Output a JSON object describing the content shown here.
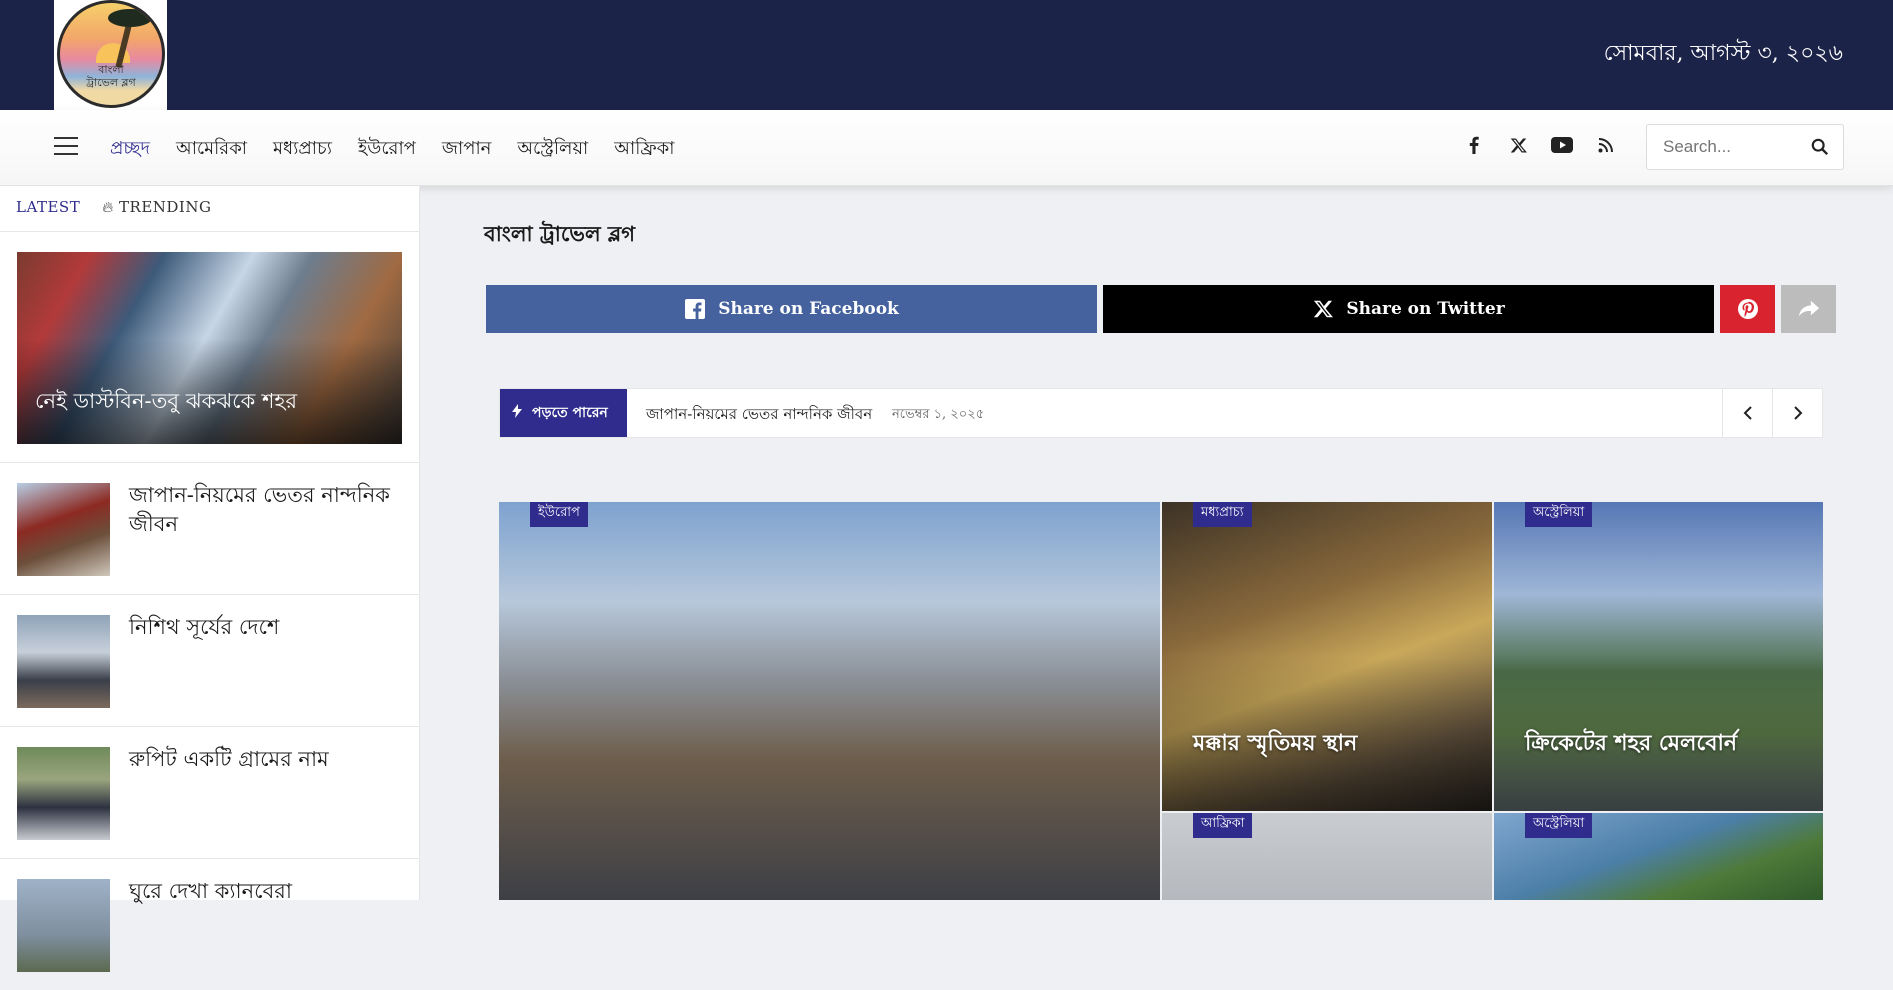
{
  "header": {
    "logo_text_line1": "বাংলা",
    "logo_text_line2": "ট্রাভেল ব্লগ",
    "date": "সোমবার, আগস্ট ৩, ২০২৬"
  },
  "nav": {
    "menu_icon": "hamburger-icon",
    "items": [
      {
        "label": "প্রচ্ছদ",
        "active": true
      },
      {
        "label": "আমেরিকা"
      },
      {
        "label": "মধ্যপ্রাচ্য"
      },
      {
        "label": "ইউরোপ"
      },
      {
        "label": "জাপান"
      },
      {
        "label": "অস্ট্রেলিয়া"
      },
      {
        "label": "আফ্রিকা"
      }
    ],
    "social": [
      "facebook-icon",
      "x-icon",
      "youtube-icon",
      "rss-icon"
    ],
    "search_placeholder": "Search..."
  },
  "sidebar": {
    "tabs": [
      {
        "label": "LATEST",
        "active": true
      },
      {
        "label": "TRENDING",
        "icon": "flame-icon"
      }
    ],
    "featured": {
      "title": "নেই ডাস্টবিন-তবু ঝকঝকে শহর"
    },
    "items": [
      {
        "title": "জাপান-নিয়মের ভেতর নান্দনিক জীবন"
      },
      {
        "title": "নিশিথ সূর্যের দেশে"
      },
      {
        "title": "রুপিট একটি গ্রামের নাম"
      },
      {
        "title": "ঘুরে দেখা ক্যানবেরা"
      }
    ]
  },
  "main": {
    "site_title": "বাংলা ট্রাভেল ব্লগ",
    "share": {
      "facebook_label": "Share on Facebook",
      "twitter_label": "Share on Twitter",
      "pinterest_icon": "pinterest-icon",
      "more_icon": "share-arrow-icon"
    },
    "ticker": {
      "label": "পড়তে পারেন",
      "title": "জাপান-নিয়মের ভেতর নান্দনিক জীবন",
      "date": "নভেম্বর ১, ২০২৫"
    },
    "grid": [
      {
        "category": "ইউরোপ",
        "title": ""
      },
      {
        "category": "মধ্যপ্রাচ্য",
        "title": "মক্কার স্মৃতিময় স্থান"
      },
      {
        "category": "অস্ট্রেলিয়া",
        "title": "ক্রিকেটের শহর মেলবোর্ন"
      },
      {
        "category": "আফ্রিকা",
        "title": ""
      },
      {
        "category": "অস্ট্রেলিয়া",
        "title": ""
      }
    ]
  },
  "colors": {
    "header_bg": "#1c2349",
    "accent": "#2f2c8e",
    "facebook": "#45629f",
    "twitter": "#000000",
    "pinterest": "#d9232e"
  }
}
